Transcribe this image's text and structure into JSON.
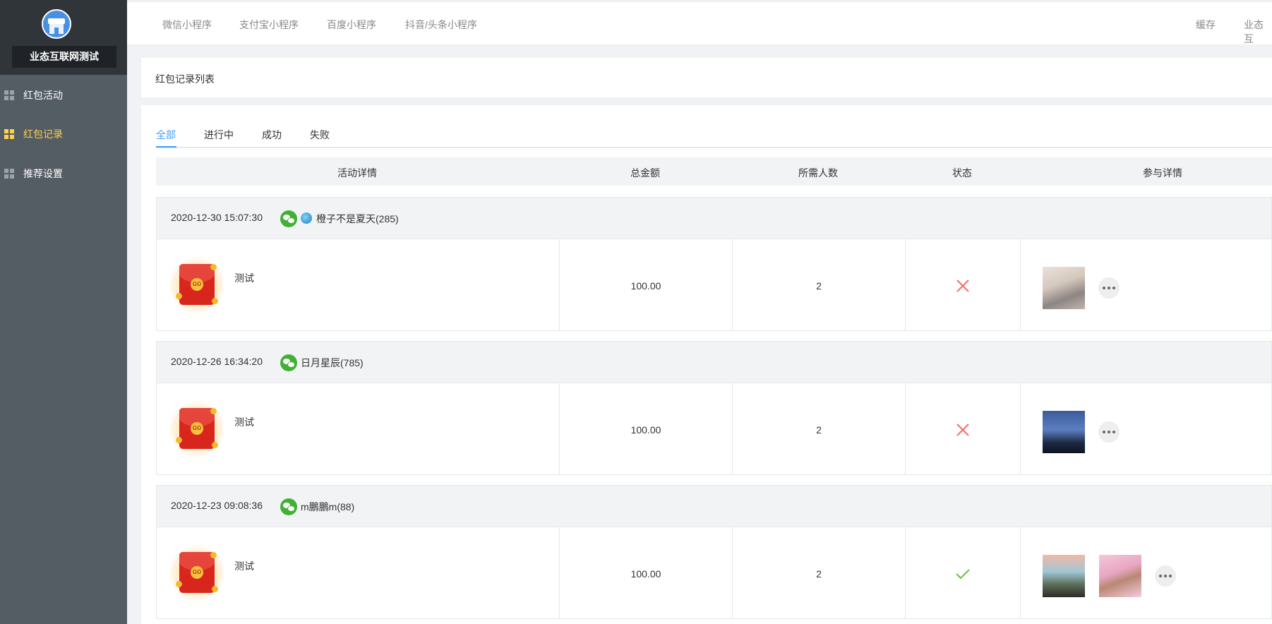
{
  "sidebar": {
    "shop_name": "业态互联网测试",
    "items": [
      {
        "label": "红包活动",
        "active": false
      },
      {
        "label": "红包记录",
        "active": true
      },
      {
        "label": "推荐设置",
        "active": false
      }
    ]
  },
  "topbar": {
    "links": [
      "微信小程序",
      "支付宝小程序",
      "百度小程序",
      "抖音/头条小程序"
    ],
    "right": [
      "缓存",
      "业态互"
    ]
  },
  "page_title": "红包记录列表",
  "tabs": [
    {
      "label": "全部",
      "active": true
    },
    {
      "label": "进行中",
      "active": false
    },
    {
      "label": "成功",
      "active": false
    },
    {
      "label": "失败",
      "active": false
    }
  ],
  "table": {
    "headers": [
      "活动详情",
      "总金额",
      "所需人数",
      "状态",
      "参与详情"
    ]
  },
  "records": [
    {
      "time": "2020-12-30 15:07:30",
      "user": "橙子不是夏天(285)",
      "has_avatar": true,
      "activity": "测试",
      "amount": "100.00",
      "people": "2",
      "status": "failed",
      "participants": 1
    },
    {
      "time": "2020-12-26 16:34:20",
      "user": "日月星辰(785)",
      "has_avatar": false,
      "activity": "测试",
      "amount": "100.00",
      "people": "2",
      "status": "failed",
      "participants": 1
    },
    {
      "time": "2020-12-23 09:08:36",
      "user": "m鵬鵬m(88)",
      "has_avatar": false,
      "activity": "测试",
      "amount": "100.00",
      "people": "2",
      "status": "success",
      "participants": 2
    }
  ],
  "colors": {
    "accent": "#409eff",
    "sidebar_active": "#ffd04b",
    "fail": "#f56c6c",
    "success": "#67c23a",
    "wechat": "#41b035"
  },
  "icons": {
    "fail": "close-icon",
    "success": "check-icon",
    "menu": "grid-icon",
    "more": "more-icon"
  }
}
